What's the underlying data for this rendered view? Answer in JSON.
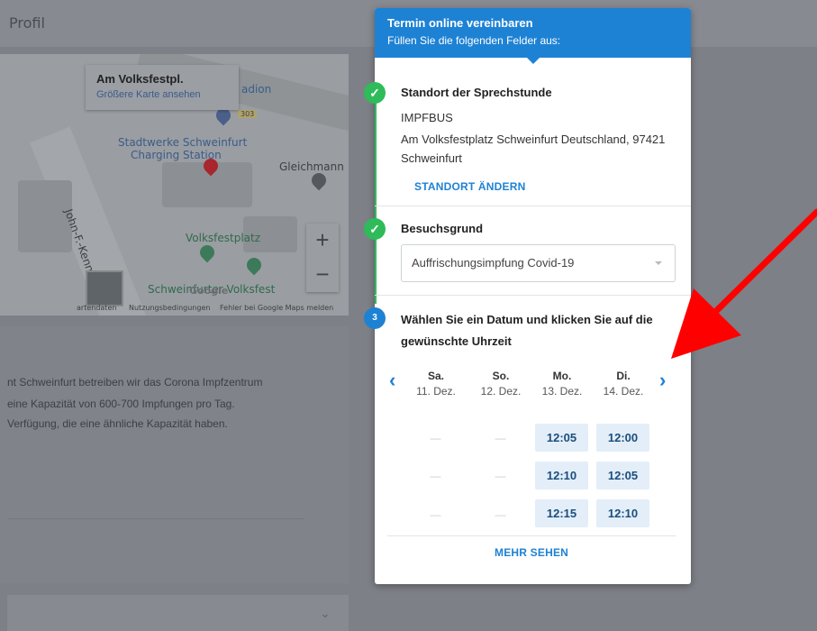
{
  "background": {
    "profil_label": "Profil",
    "map": {
      "place_title": "Am Volksfestpl.",
      "larger_map_link": "Größere Karte ansehen",
      "labels": [
        {
          "name": "map-label-stadion",
          "text": "adion",
          "style": "blue"
        },
        {
          "name": "map-label-stadtwerke",
          "text": "Stadtwerke Schweinfurt",
          "style": "blue"
        },
        {
          "name": "map-label-charging",
          "text": "Charging Station",
          "style": "blue"
        },
        {
          "name": "map-label-gleichmann",
          "text": "Gleichmann",
          "style": ""
        },
        {
          "name": "map-label-john-f-kennedy",
          "text": "John-F.-Kenne",
          "style": ""
        },
        {
          "name": "map-label-volksfestplatz",
          "text": "Volksfestplatz",
          "style": "green"
        },
        {
          "name": "map-label-schweinfurter-volksfest",
          "text": "Schweinfurter Volksfest",
          "style": "green"
        },
        {
          "name": "map-label-road-303",
          "text": "303",
          "style": ""
        }
      ],
      "zoom_in": "+",
      "zoom_out": "−",
      "footer_kartendaten": "artendaten",
      "footer_nutzung": "Nutzungsbedingungen",
      "footer_fehler": "Fehler bei Google Maps melden",
      "google_logo": "Google"
    },
    "description_lines": [
      "nt Schweinfurt betreiben wir das Corona Impfzentrum",
      " eine Kapazität von 600-700 Impfungen pro Tag.",
      " Verfügung, die eine ähnliche Kapazität haben."
    ]
  },
  "booking": {
    "header_title": "Termin online vereinbaren",
    "header_subtitle": "Füllen Sie die folgenden Felder aus:",
    "step1": {
      "title": "Standort der Sprechstunde",
      "name": "IMPFBUS",
      "address_line1": "Am Volksfestplatz Schweinfurt Deutschland, 97421",
      "address_line2": "Schweinfurt",
      "change_link": "STANDORT ÄNDERN"
    },
    "step2": {
      "title": "Besuchsgrund",
      "selected_reason": "Auffrischungsimpfung Covid-19"
    },
    "step3": {
      "number": "3",
      "title_line1": "Wählen Sie ein Datum und klicken Sie auf die",
      "title_line2": "gewünschte Uhrzeit",
      "prev_icon": "‹",
      "next_icon": "›",
      "days": [
        {
          "name": "Sa.",
          "date": "11. Dez."
        },
        {
          "name": "So.",
          "date": "12. Dez."
        },
        {
          "name": "Mo.",
          "date": "13. Dez."
        },
        {
          "name": "Di.",
          "date": "14. Dez."
        }
      ],
      "slots": [
        [
          "—",
          "—",
          "12:05",
          "12:00"
        ],
        [
          "—",
          "—",
          "12:10",
          "12:05"
        ],
        [
          "—",
          "—",
          "12:15",
          "12:10"
        ]
      ],
      "more_link": "MEHR SEHEN"
    }
  },
  "colors": {
    "accent": "#1e82d4",
    "success": "#2fbb59",
    "slot_bg": "#e3eef9",
    "annotation_arrow": "#ff0000"
  }
}
